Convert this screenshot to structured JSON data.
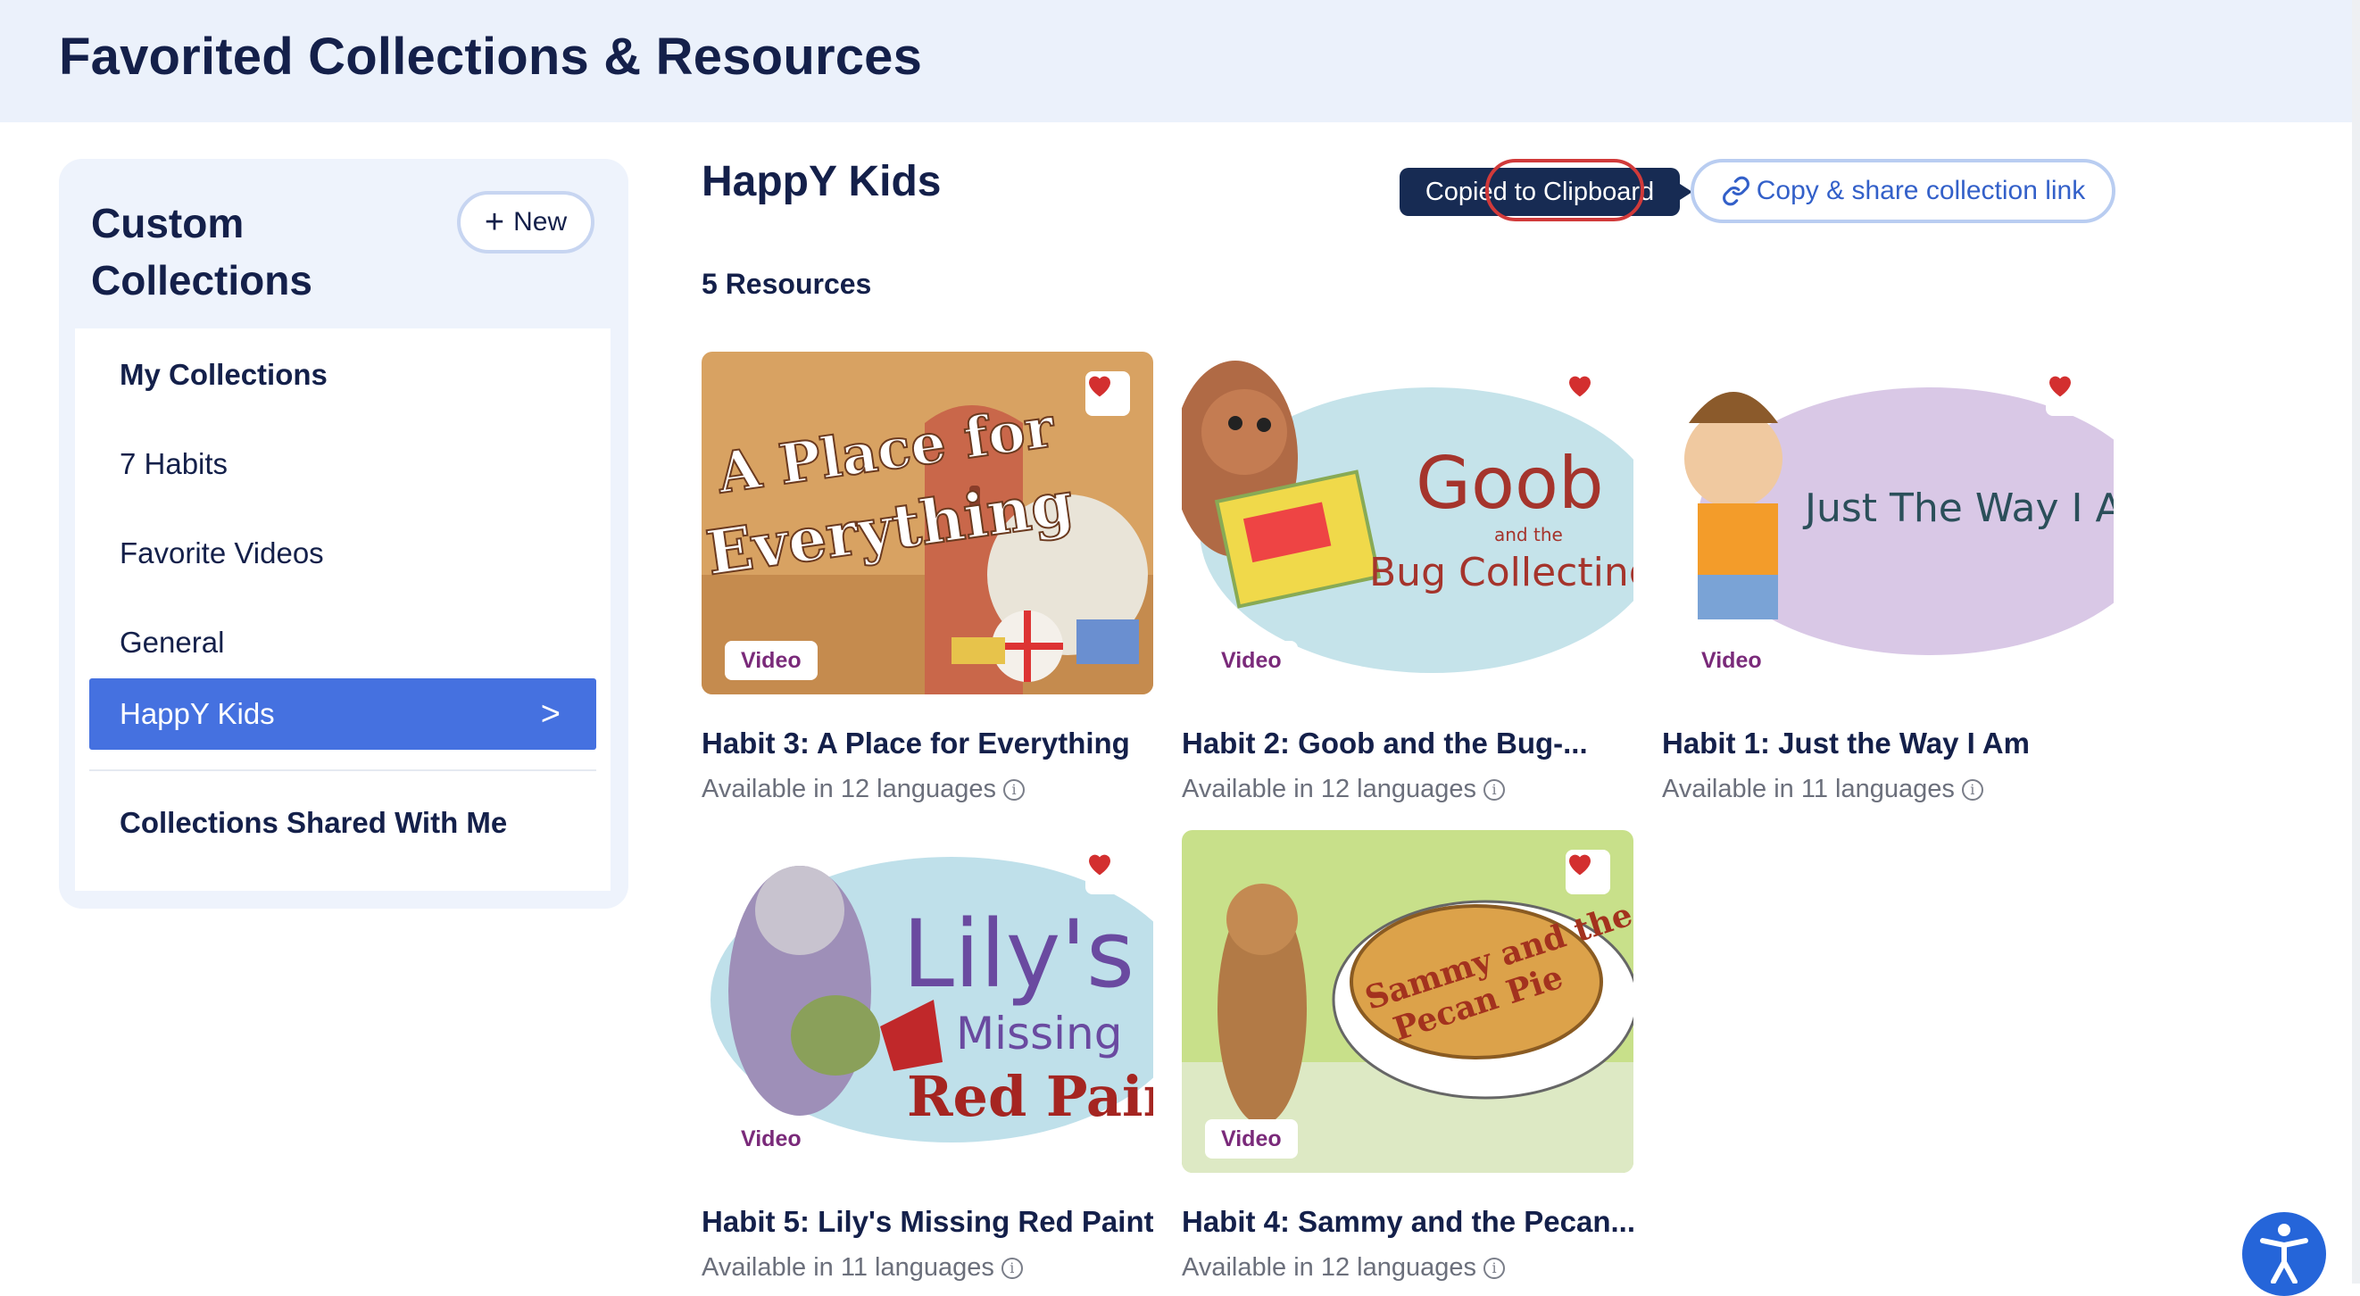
{
  "header": {
    "title": "Favorited Collections & Resources"
  },
  "sidebar": {
    "title": "Custom\nCollections",
    "new_button": {
      "icon": "plus-icon",
      "label": "New"
    },
    "items": [
      {
        "label": "My Collections"
      },
      {
        "label": "7 Habits"
      },
      {
        "label": "Favorite Videos"
      },
      {
        "label": "General"
      },
      {
        "label": "HappY Kids",
        "active": true,
        "icon": "chevron-right-icon",
        "glyph": ">"
      },
      {
        "label": "Collections Shared With Me"
      }
    ]
  },
  "main": {
    "collection_title": "HappY Kids",
    "resources_count": "5 Resources",
    "tooltip": "Copied to Clipboard",
    "share_button": {
      "icon": "link-icon",
      "label": "Copy & share collection link"
    },
    "cards": [
      {
        "title": "Habit 3: A Place for Everything",
        "languages": "Available in 12 languages",
        "badge": "Video",
        "thumb_text": [
          "A Place for",
          "Everything"
        ],
        "favorited": true
      },
      {
        "title": "Habit 2: Goob and the Bug-...",
        "languages": "Available in 12 languages",
        "badge": "Video",
        "thumb_text": [
          "Goob",
          "and the",
          "Bug Collecting"
        ],
        "favorited": true
      },
      {
        "title": "Habit 1: Just the Way I Am",
        "languages": "Available in 11 languages",
        "badge": "Video",
        "thumb_text": [
          "Just The Way I A"
        ],
        "favorited": true
      },
      {
        "title": "Habit 5: Lily's Missing Red Paint",
        "languages": "Available in 11 languages",
        "badge": "Video",
        "thumb_text": [
          "Lily's",
          "Missing",
          "Red Pain"
        ],
        "favorited": true
      },
      {
        "title": "Habit 4: Sammy and the Pecan...",
        "languages": "Available in 12 languages",
        "badge": "Video",
        "thumb_text": [
          "Sammy and the",
          "Pecan Pie"
        ],
        "favorited": true
      }
    ]
  },
  "accessibility_button": {
    "icon": "accessibility-person-icon"
  },
  "colors": {
    "accent": "#4571e0",
    "navy": "#14204a",
    "heart": "#d32f2f",
    "tooltip": "#172b53",
    "link": "#3360c9",
    "header_bg": "#ebf1fb"
  }
}
